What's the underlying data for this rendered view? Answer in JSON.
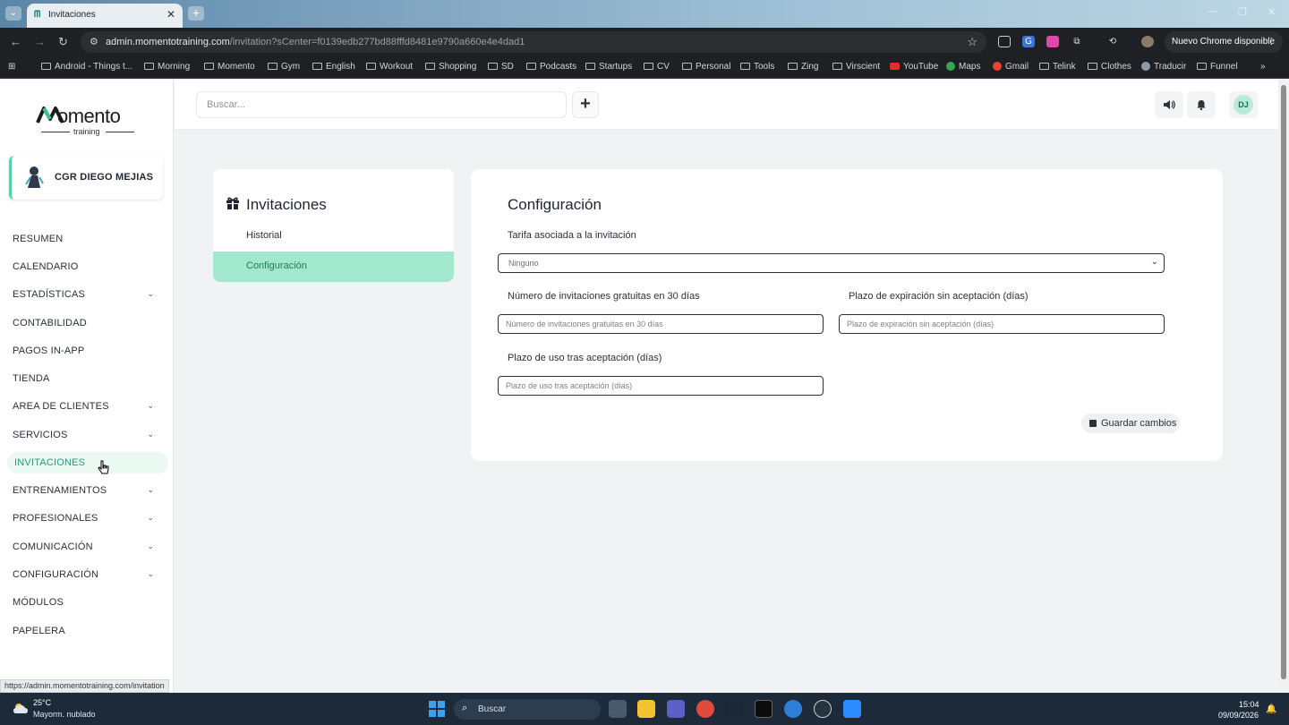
{
  "browser": {
    "tab_title": "Invitaciones",
    "tab_close": "✕",
    "new_tab": "+",
    "url_domain": "admin.momentotraining.com",
    "url_rest": "/invitation?sCenter=f0139edb277bd88fffd8481e9790a660e4e4dad1",
    "update_label": "Nuevo Chrome disponible",
    "bookmarks": [
      "Android - Things t...",
      "Morning",
      "Momento",
      "Gym",
      "English",
      "Workout",
      "Shopping",
      "SD",
      "Podcasts",
      "Startups",
      "CV",
      "Personal",
      "Tools",
      "Zing",
      "Virscient",
      "YouTube",
      "Maps",
      "Gmail",
      "Telink",
      "Clothes",
      "Traducir",
      "Funnel"
    ],
    "status_url": "https://admin.momentotraining.com/invitation"
  },
  "logo": {
    "name": "omento",
    "sub": "training"
  },
  "center": {
    "name": "CGR DIEGO MEJIAS"
  },
  "menu": [
    {
      "label": "RESUMEN",
      "chevron": false
    },
    {
      "label": "CALENDARIO",
      "chevron": false
    },
    {
      "label": "ESTADÍSTICAS",
      "chevron": true
    },
    {
      "label": "CONTABILIDAD",
      "chevron": false
    },
    {
      "label": "PAGOS IN-APP",
      "chevron": false
    },
    {
      "label": "TIENDA",
      "chevron": false
    },
    {
      "label": "AREA DE CLIENTES",
      "chevron": true
    },
    {
      "label": "SERVICIOS",
      "chevron": true
    },
    {
      "label": "INVITACIONES",
      "chevron": false,
      "active": true
    },
    {
      "label": "ENTRENAMIENTOS",
      "chevron": true
    },
    {
      "label": "PROFESIONALES",
      "chevron": true
    },
    {
      "label": "COMUNICACIÓN",
      "chevron": true
    },
    {
      "label": "CONFIGURACIÓN",
      "chevron": true
    },
    {
      "label": "MÓDULOS",
      "chevron": false
    },
    {
      "label": "PAPELERA",
      "chevron": false
    }
  ],
  "header": {
    "search_placeholder": "Buscar...",
    "add_label": "+",
    "user_initials": "DJ"
  },
  "subnav": {
    "title": "Invitaciones",
    "items": [
      {
        "label": "Historial",
        "active": false
      },
      {
        "label": "Configuración",
        "active": true
      }
    ]
  },
  "config": {
    "title": "Configuración",
    "tarifa_label": "Tarifa asociada a la invitación",
    "tarifa_value": "Ninguno",
    "gratuitas_label": "Número de invitaciones gratuitas en 30 días",
    "gratuitas_placeholder": "Número de invitaciones gratuitas en 30 días",
    "expiracion_label": "Plazo de expiración sin aceptación (días)",
    "expiracion_placeholder": "Plazo de expiración sin aceptación (días)",
    "uso_label": "Plazo de uso tras aceptación (días)",
    "uso_placeholder": "Plazo de uso tras aceptación (días)",
    "save_label": "Guardar cambios"
  },
  "taskbar": {
    "temperature": "25°C",
    "weather": "Mayorm. nublado",
    "search": "Buscar",
    "time": "15:04",
    "date": "09/09/2026"
  }
}
